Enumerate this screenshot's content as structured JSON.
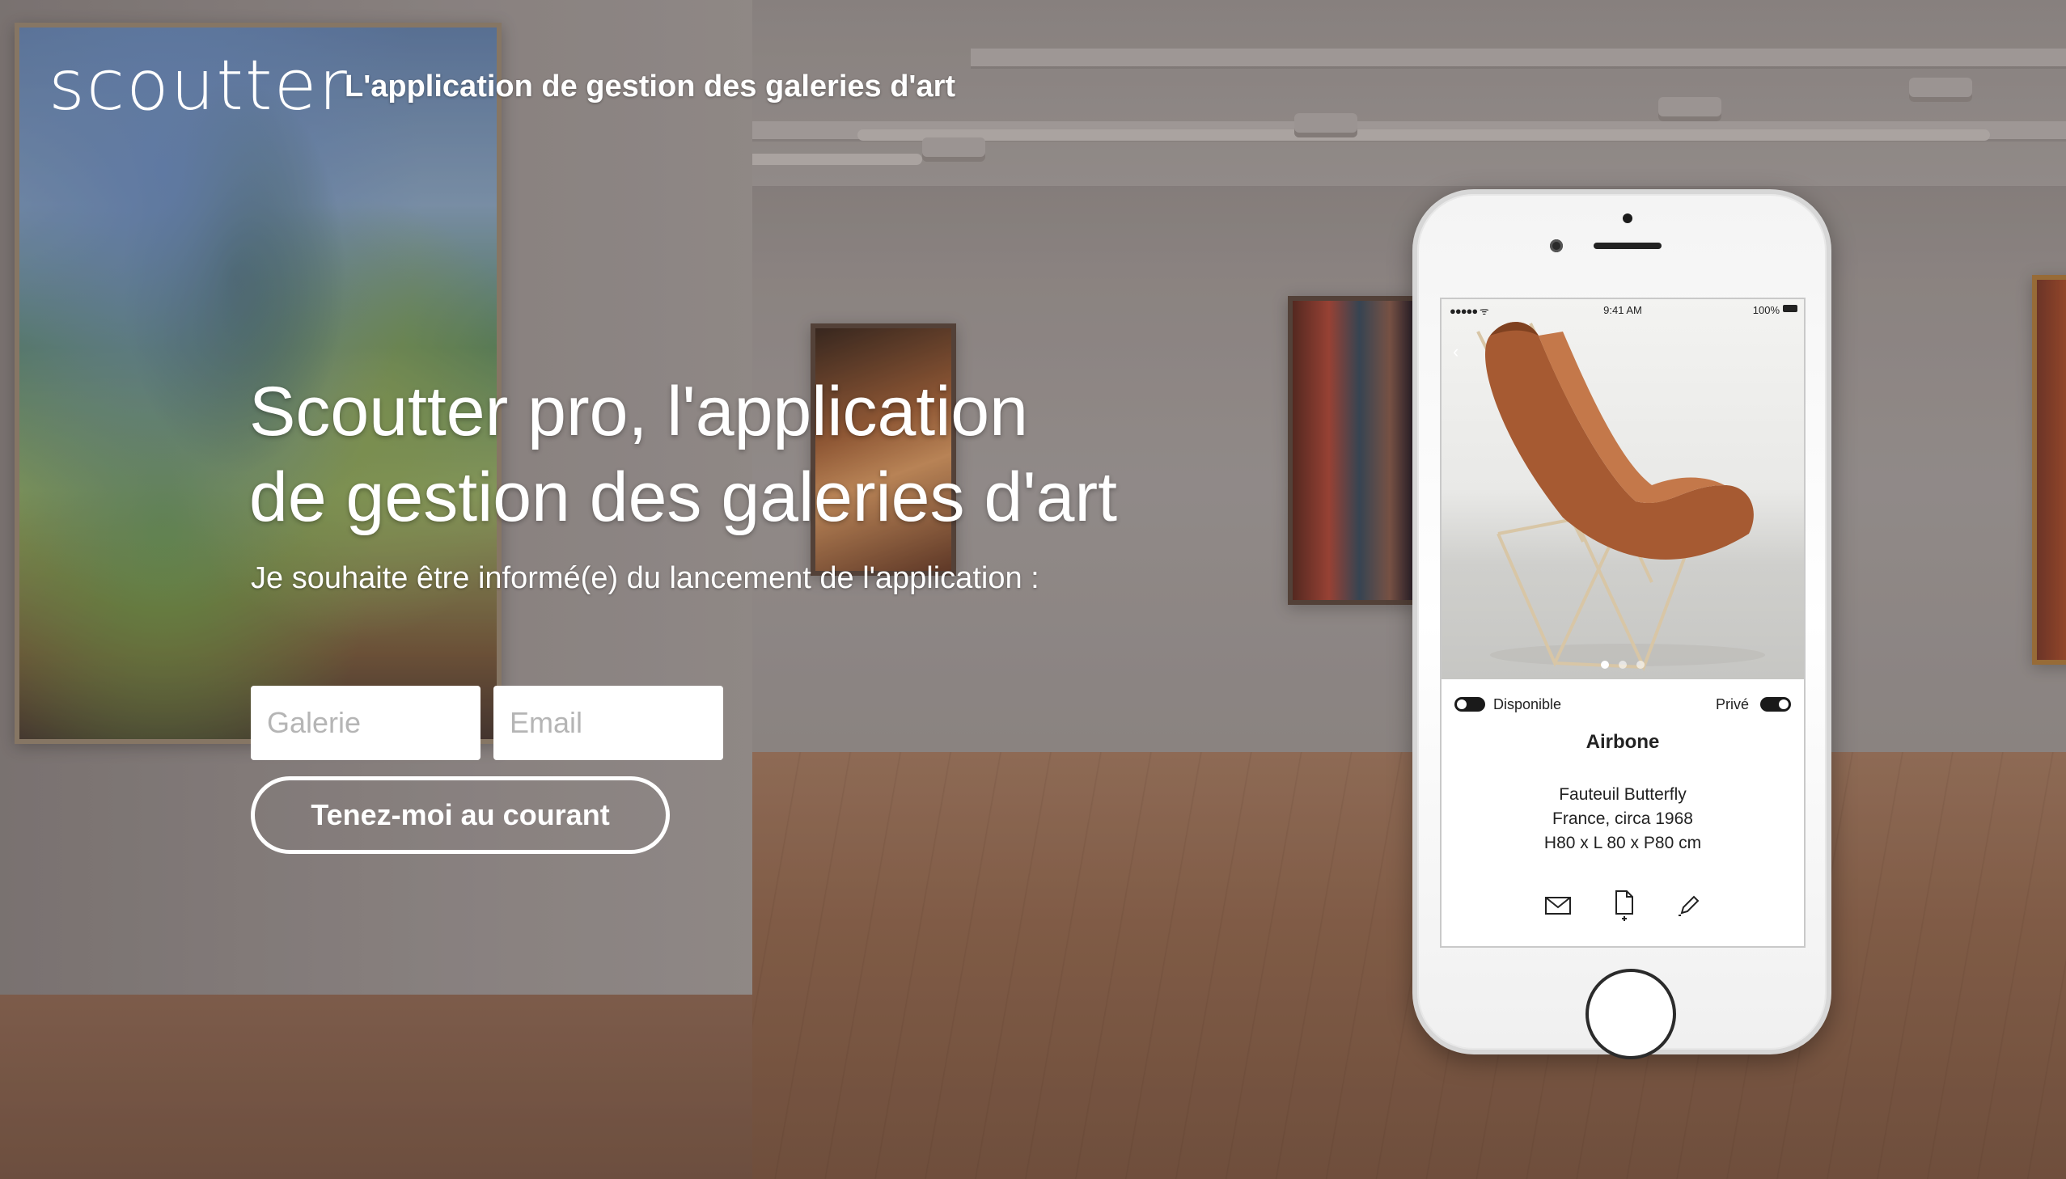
{
  "brand": {
    "logo": "scoutter",
    "tagline": "L'application de gestion des galeries d'art"
  },
  "hero": {
    "title_line1": "Scoutter pro, l'application",
    "title_line2": "de gestion des galeries d'art",
    "subtitle": "Je souhaite être informé(e) du lancement de l'application :"
  },
  "form": {
    "galerie_placeholder": "Galerie",
    "email_placeholder": "Email",
    "submit_label": "Tenez-moi au courant"
  },
  "phone": {
    "status": {
      "signal": "●●●●● ᯤ",
      "time": "9:41 AM",
      "battery": "100%"
    },
    "back_icon": "chevron-left-icon",
    "carousel": {
      "count": 3,
      "active": 0
    },
    "toggle_left_label": "Disponible",
    "toggle_right_label": "Privé",
    "item_name": "Airbone",
    "item_desc": [
      "Fauteuil Butterfly",
      "France, circa 1968",
      "H80 x L 80 x P80 cm"
    ],
    "actions": [
      "mail-icon",
      "document-add-icon",
      "pencil-icon"
    ]
  },
  "colors": {
    "text": "#ffffff",
    "button_border": "#ffffff",
    "leather": "#a65a32"
  }
}
